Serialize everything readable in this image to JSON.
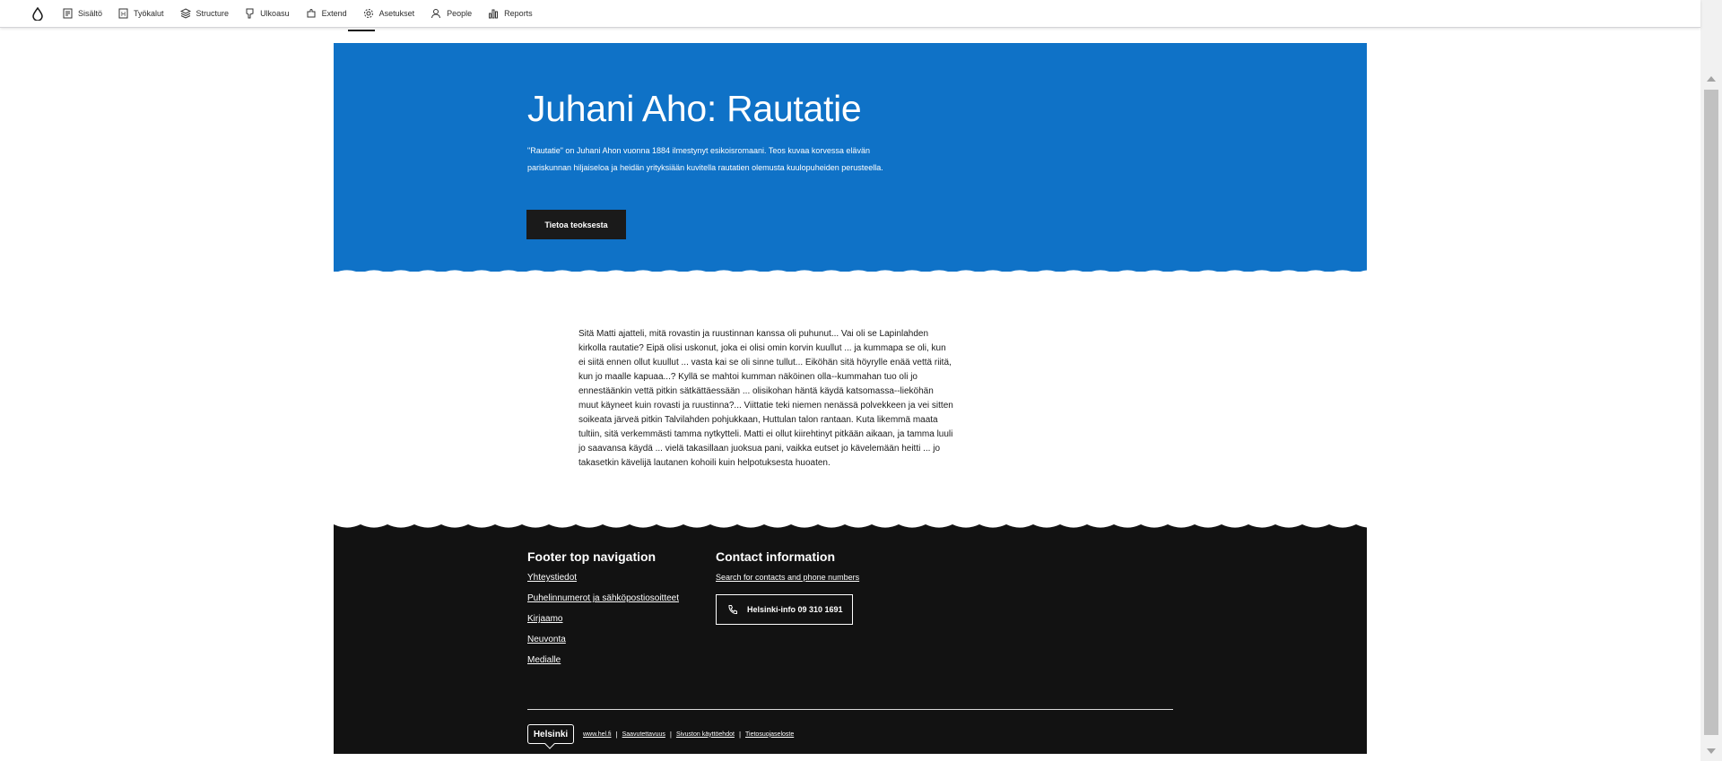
{
  "toolbar": {
    "items": [
      {
        "label": "Sisältö",
        "icon": "document-icon"
      },
      {
        "label": "Työkalut",
        "icon": "tools-icon"
      },
      {
        "label": "Structure",
        "icon": "structure-icon"
      },
      {
        "label": "Ulkoasu",
        "icon": "appearance-icon"
      },
      {
        "label": "Extend",
        "icon": "puzzle-icon"
      },
      {
        "label": "Asetukset",
        "icon": "gear-icon"
      },
      {
        "label": "People",
        "icon": "person-icon"
      },
      {
        "label": "Reports",
        "icon": "chart-icon"
      }
    ]
  },
  "hero": {
    "title": "Juhani Aho: Rautatie",
    "lead": "\"Rautatie\" on Juhani Ahon vuonna 1884 ilmestynyt esikoisromaani. Teos kuvaa korvessa elävän pariskunnan hiljaiseloa ja heidän yrityksiään kuvitella rautatien olemusta kuulopuheiden perusteella.",
    "button_label": "Tietoa teoksesta",
    "background": "#0f72c7"
  },
  "article": {
    "body": "Sitä Matti ajatteli, mitä rovastin ja ruustinnan kanssa oli puhunut... Vai oli se Lapinlahden kirkolla rautatie? Eipä olisi uskonut, joka ei olisi omin korvin kuullut ... ja kummapa se oli, kun ei siitä ennen ollut kuullut ... vasta kai se oli sinne tullut... Eiköhän sitä höyrylle enää vettä riitä, kun jo maalle kapuaa...? Kyllä se mahtoi kumman näköinen olla--kummahan tuo oli jo ennestäänkin vettä pitkin sätkättäessään ... olisikohan häntä käydä katsomassa--liekö­hän muut käyneet kuin rovasti ja ruustinna?... Viittatie teki niemen nenässä polvekkeen ja vei sitten soikeata järveä pitkin Talvilahden pohjukkaan, Huttulan talon rantaan. Kuta likemmä maata tultiin, sitä verkemmästi tamma nytkytteli. Matti ei ollut kiirehtinyt pitkään aikaan, ja tamma luuli jo saavansa käydä ... vielä takasillaan juoksua pani, vaikka eutset jo kävelemään heitti ... jo takasetkin kävelijä lautanen kohoili kuin helpotuksesta huoaten."
  },
  "footer": {
    "nav_heading": "Footer top navigation",
    "nav_links": [
      "Yhteystiedot",
      "Puhelinnumerot ja sähköpostiosoitteet",
      "Kirjaamo",
      "Neuvonta",
      "Medialle"
    ],
    "contact_heading": "Contact information",
    "contact_link": "Search for contacts and phone numbers",
    "phone_label": "Helsinki-info 09 310 1691",
    "logo_text": "Helsinki",
    "bottom_links": [
      "www.hel.fi",
      "Saavutettavuus",
      "Sivuston käyttöehdot",
      "Tietosuojaseloste"
    ],
    "background": "#121212"
  }
}
